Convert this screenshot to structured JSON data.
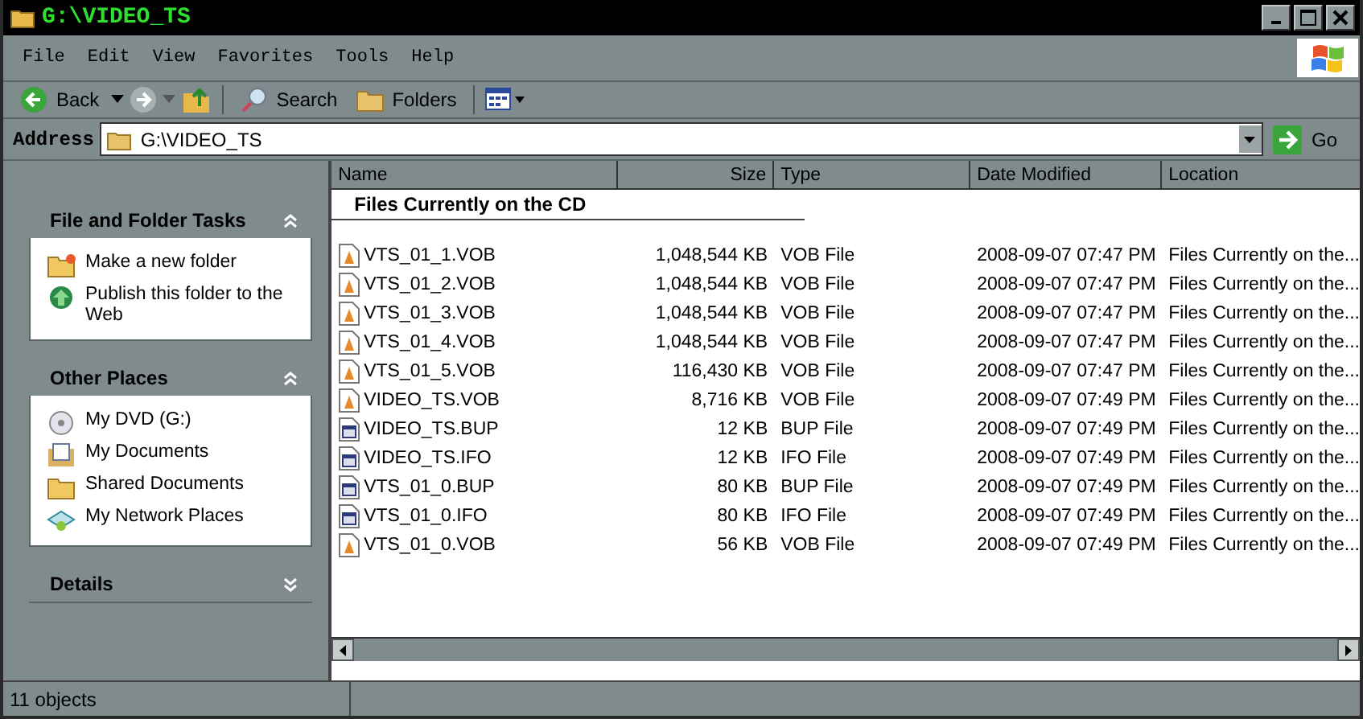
{
  "window": {
    "title": "G:\\VIDEO_TS"
  },
  "menu": [
    "File",
    "Edit",
    "View",
    "Favorites",
    "Tools",
    "Help"
  ],
  "toolbar": {
    "back": "Back",
    "search": "Search",
    "folders": "Folders"
  },
  "address": {
    "label": "Address",
    "value": "G:\\VIDEO_TS",
    "go": "Go"
  },
  "panels": [
    {
      "title": "File and Folder Tasks",
      "expanded": true,
      "items": [
        {
          "kind": "newfolder",
          "label": "Make a new folder"
        },
        {
          "kind": "publish",
          "label": "Publish this folder to the Web"
        }
      ]
    },
    {
      "title": "Other Places",
      "expanded": true,
      "items": [
        {
          "kind": "dvd",
          "label": "My DVD (G:)"
        },
        {
          "kind": "documents",
          "label": "My Documents"
        },
        {
          "kind": "folder",
          "label": "Shared Documents"
        },
        {
          "kind": "network",
          "label": "My Network Places"
        }
      ]
    },
    {
      "title": "Details",
      "expanded": false
    }
  ],
  "table": {
    "columns": [
      "Name",
      "Size",
      "Type",
      "Date Modified",
      "Location"
    ],
    "group": "Files Currently on the CD",
    "rows": [
      {
        "kind": "vob",
        "name": "VTS_01_1.VOB",
        "size": "1,048,544 KB",
        "type": "VOB File",
        "date": "2008-09-07 07:47 PM",
        "location": "Files Currently on the..."
      },
      {
        "kind": "vob",
        "name": "VTS_01_2.VOB",
        "size": "1,048,544 KB",
        "type": "VOB File",
        "date": "2008-09-07 07:47 PM",
        "location": "Files Currently on the..."
      },
      {
        "kind": "vob",
        "name": "VTS_01_3.VOB",
        "size": "1,048,544 KB",
        "type": "VOB File",
        "date": "2008-09-07 07:47 PM",
        "location": "Files Currently on the..."
      },
      {
        "kind": "vob",
        "name": "VTS_01_4.VOB",
        "size": "1,048,544 KB",
        "type": "VOB File",
        "date": "2008-09-07 07:47 PM",
        "location": "Files Currently on the..."
      },
      {
        "kind": "vob",
        "name": "VTS_01_5.VOB",
        "size": "116,430 KB",
        "type": "VOB File",
        "date": "2008-09-07 07:47 PM",
        "location": "Files Currently on the..."
      },
      {
        "kind": "vob",
        "name": "VIDEO_TS.VOB",
        "size": "8,716 KB",
        "type": "VOB File",
        "date": "2008-09-07 07:49 PM",
        "location": "Files Currently on the..."
      },
      {
        "kind": "data",
        "name": "VIDEO_TS.BUP",
        "size": "12 KB",
        "type": "BUP File",
        "date": "2008-09-07 07:49 PM",
        "location": "Files Currently on the..."
      },
      {
        "kind": "data",
        "name": "VIDEO_TS.IFO",
        "size": "12 KB",
        "type": "IFO File",
        "date": "2008-09-07 07:49 PM",
        "location": "Files Currently on the..."
      },
      {
        "kind": "data",
        "name": "VTS_01_0.BUP",
        "size": "80 KB",
        "type": "BUP File",
        "date": "2008-09-07 07:49 PM",
        "location": "Files Currently on the..."
      },
      {
        "kind": "data",
        "name": "VTS_01_0.IFO",
        "size": "80 KB",
        "type": "IFO File",
        "date": "2008-09-07 07:49 PM",
        "location": "Files Currently on the..."
      },
      {
        "kind": "vob",
        "name": "VTS_01_0.VOB",
        "size": "56 KB",
        "type": "VOB File",
        "date": "2008-09-07 07:49 PM",
        "location": "Files Currently on the..."
      }
    ]
  },
  "status_bar": "11 objects"
}
